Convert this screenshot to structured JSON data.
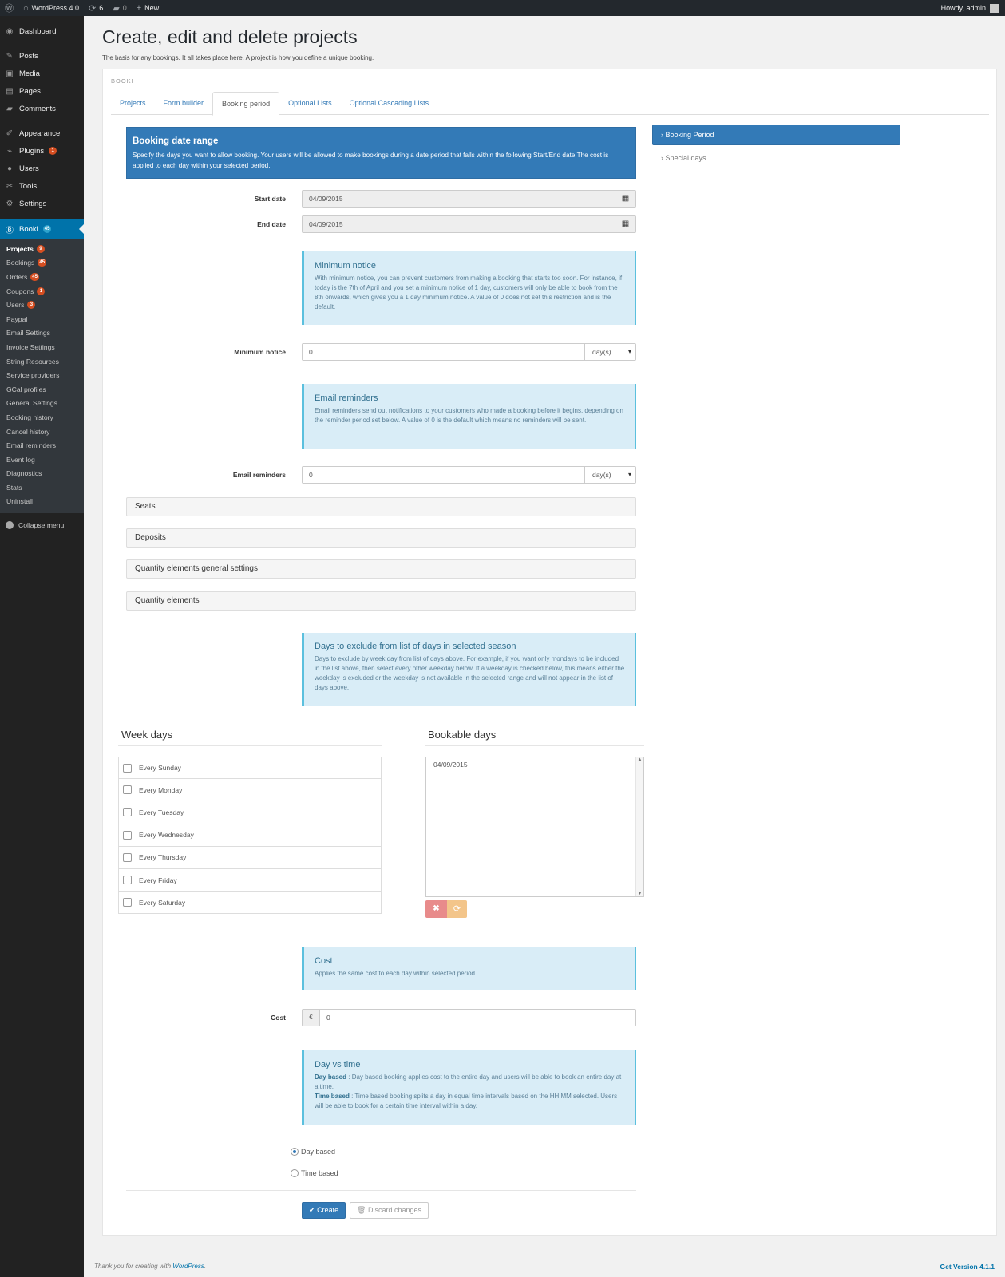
{
  "adminbar": {
    "site_name": "WordPress 4.0",
    "updates_count": "6",
    "comments_count": "0",
    "new_label": "New",
    "howdy": "Howdy, admin"
  },
  "sidebar": {
    "items": [
      {
        "label": "Dashboard",
        "icon": "dashboard-icon"
      },
      {
        "label": "Posts",
        "icon": "pin-icon"
      },
      {
        "label": "Media",
        "icon": "media-icon"
      },
      {
        "label": "Pages",
        "icon": "page-icon"
      },
      {
        "label": "Comments",
        "icon": "comment-icon"
      },
      {
        "label": "Appearance",
        "icon": "brush-icon"
      },
      {
        "label": "Plugins",
        "icon": "plug-icon",
        "badge": "1"
      },
      {
        "label": "Users",
        "icon": "user-icon"
      },
      {
        "label": "Tools",
        "icon": "wrench-icon"
      },
      {
        "label": "Settings",
        "icon": "settings-icon"
      }
    ],
    "booki": {
      "label": "Booki",
      "badge": "45"
    },
    "submenu": [
      {
        "label": "Projects",
        "badge": "9"
      },
      {
        "label": "Bookings",
        "badge": "45"
      },
      {
        "label": "Orders",
        "badge": "45"
      },
      {
        "label": "Coupons",
        "badge": "1"
      },
      {
        "label": "Users",
        "badge": "3"
      },
      {
        "label": "Paypal"
      },
      {
        "label": "Email Settings"
      },
      {
        "label": "Invoice Settings"
      },
      {
        "label": "String Resources"
      },
      {
        "label": "Service providers"
      },
      {
        "label": "GCal profiles"
      },
      {
        "label": "General Settings"
      },
      {
        "label": "Booking history"
      },
      {
        "label": "Cancel history"
      },
      {
        "label": "Email reminders"
      },
      {
        "label": "Event log"
      },
      {
        "label": "Diagnostics"
      },
      {
        "label": "Stats"
      },
      {
        "label": "Uninstall"
      }
    ],
    "collapse": "Collapse menu"
  },
  "page": {
    "title": "Create, edit and delete projects",
    "subtitle": "The basis for any bookings. It all takes place here. A project is how you define a unique booking."
  },
  "panel": {
    "brand": "BOOKI",
    "tabs": [
      "Projects",
      "Form builder",
      "Booking period",
      "Optional Lists",
      "Optional Cascading Lists"
    ]
  },
  "booking_range": {
    "title": "Booking date range",
    "text": "Specify the days you want to allow booking. Your users will be allowed to make bookings during a date period that falls within the following Start/End date.The cost is applied to each day within your selected period."
  },
  "side_nav": {
    "active": "Booking Period",
    "other": "Special days"
  },
  "form": {
    "start_label": "Start date",
    "start_value": "04/09/2015",
    "end_label": "End date",
    "end_value": "04/09/2015",
    "min_notice_label": "Minimum notice",
    "min_notice_value": "0",
    "min_notice_unit": "day(s)",
    "email_rem_label": "Email reminders",
    "email_rem_value": "0",
    "email_rem_unit": "day(s)",
    "cost_label": "Cost",
    "cost_currency": "€",
    "cost_value": "0"
  },
  "info": {
    "min_notice_title": "Minimum notice",
    "min_notice_text": "With minimum notice, you can prevent customers from making a booking that starts too soon. For instance, if today is the 7th of April and you set a minimum notice of 1 day, customers will only be able to book from the 8th onwards, which gives you a 1 day minimum notice. A value of 0 does not set this restriction and is the default.",
    "email_title": "Email reminders",
    "email_text": "Email reminders send out notifications to your customers who made a booking before it begins, depending on the reminder period set below. A value of 0 is the default which means no reminders will be sent.",
    "exclude_title": "Days to exclude from list of days in selected season",
    "exclude_text": "Days to exclude by week day from list of days above. For example, if you want only mondays to be included in the list above, then select every other weekday below. If a weekday is checked below, this means either the weekday is excluded or the weekday is not available in the selected range and will not appear in the list of days above.",
    "cost_title": "Cost",
    "cost_text": "Applies the same cost to each day within selected period.",
    "dvt_title": "Day vs time",
    "dvt_day_bold": "Day based",
    "dvt_day_text": " : Day based booking applies cost to the entire day and users will be able to book an entire day at a time.",
    "dvt_time_bold": "Time based",
    "dvt_time_text": " : Time based booking splits a day in equal time intervals based on the HH:MM selected. Users will be able to book for a certain time interval within a day."
  },
  "accordions": [
    "Seats",
    "Deposits",
    "Quantity elements general settings",
    "Quantity elements"
  ],
  "weekdays": {
    "title": "Week days",
    "items": [
      "Every Sunday",
      "Every Monday",
      "Every Tuesday",
      "Every Wednesday",
      "Every Thursday",
      "Every Friday",
      "Every Saturday"
    ]
  },
  "bookable": {
    "title": "Bookable days",
    "items": [
      "04/09/2015"
    ]
  },
  "radios": {
    "day": "Day based",
    "time": "Time based"
  },
  "buttons": {
    "create": "Create",
    "discard": "Discard changes"
  },
  "footer": {
    "thanks": "Thank you for creating with ",
    "wp_link": "WordPress",
    "thanks_end": ".",
    "version": "Get Version 4.1.1"
  },
  "colors": {
    "primary": "#337ab7",
    "info_bg": "#d9edf7",
    "sidebar_bg": "#222222",
    "active_menu": "#0073aa"
  }
}
